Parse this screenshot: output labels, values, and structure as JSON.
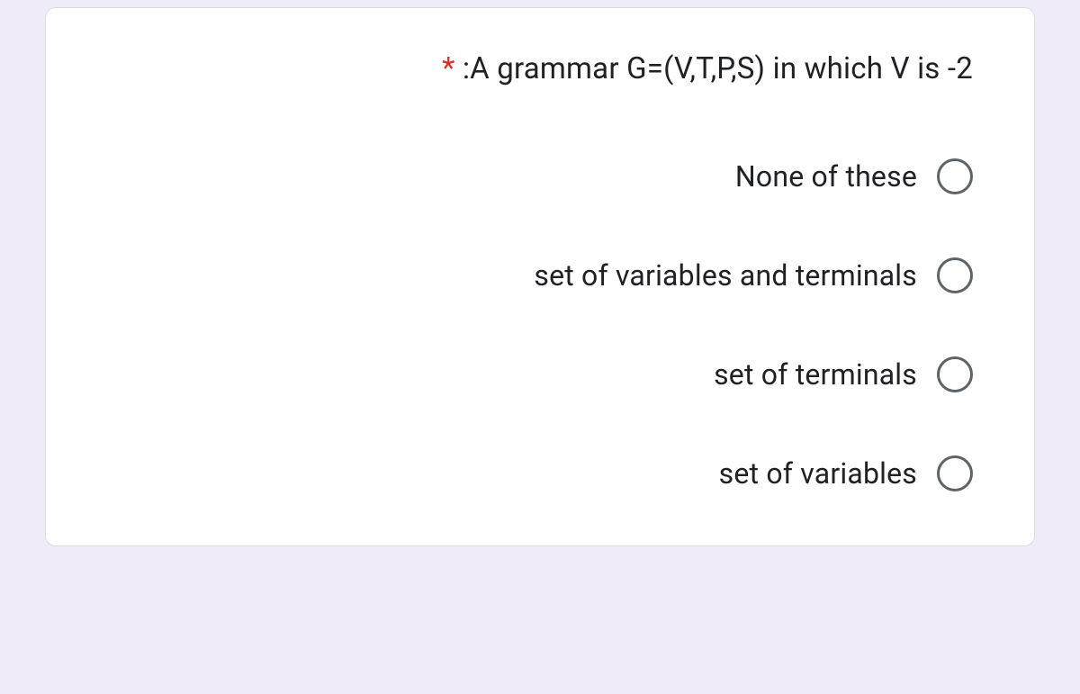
{
  "question": {
    "required_marker": "*",
    "text": ":A grammar G=(V,T,P,S) in which V is -2"
  },
  "options": [
    {
      "label": "None of these"
    },
    {
      "label": "set of variables and terminals"
    },
    {
      "label": "set of terminals"
    },
    {
      "label": "set of variables"
    }
  ]
}
